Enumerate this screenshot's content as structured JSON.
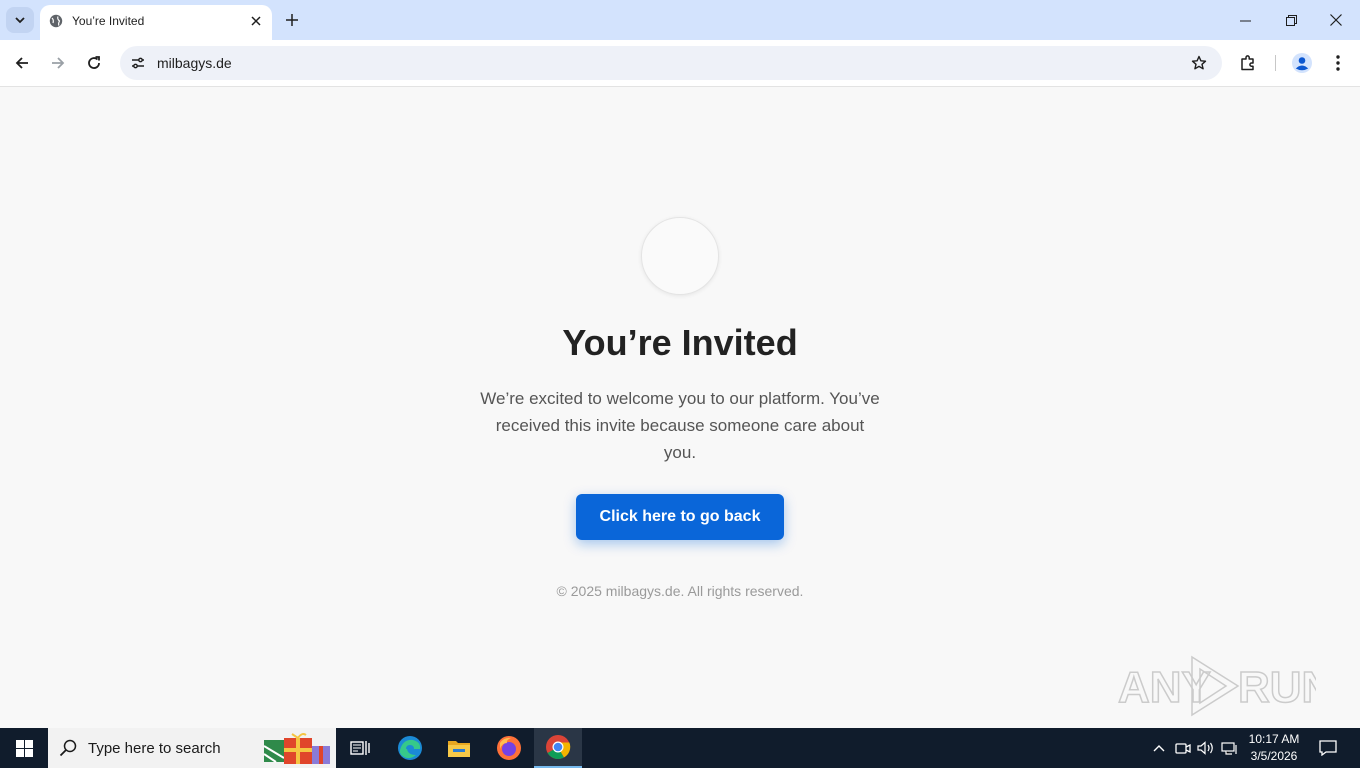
{
  "browser": {
    "tab_title": "You’re Invited",
    "url": "milbagys.de"
  },
  "page": {
    "heading": "You’re Invited",
    "description": "We’re excited to welcome you to our platform. You’ve received this invite because someone care about you.",
    "cta_label": "Click here to go back",
    "footer": "© 2025 milbagys.de. All rights reserved.",
    "watermark": "ANY RUN",
    "accent_color": "#0a66d9"
  },
  "taskbar": {
    "search_placeholder": "Type here to search",
    "time": "10:17 AM",
    "date": "3/5/2026"
  }
}
